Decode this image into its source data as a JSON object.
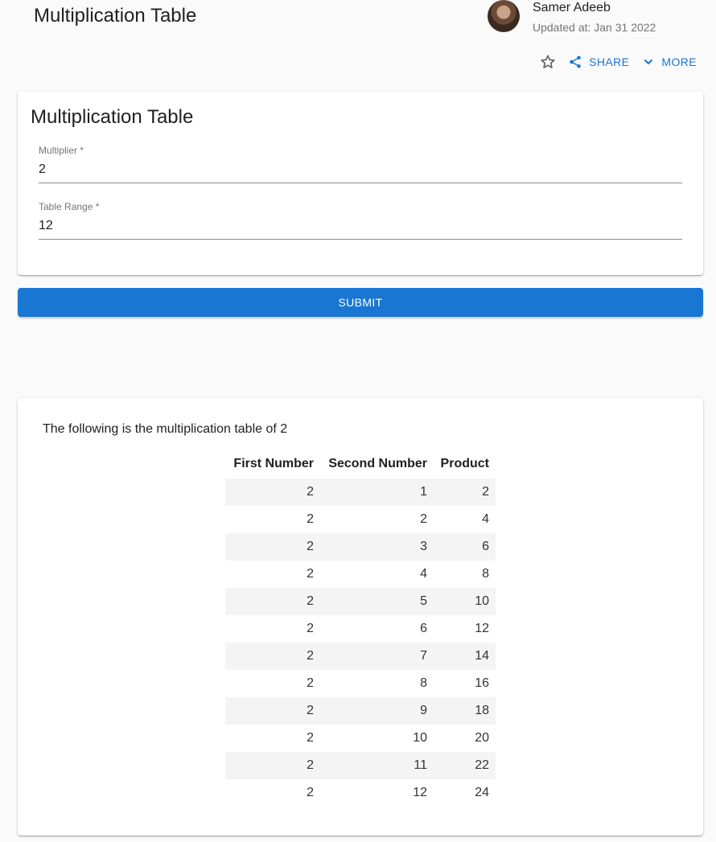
{
  "header": {
    "title": "Multiplication Table",
    "author_name": "Samer Adeeb",
    "updated": "Updated at: Jan 31 2022",
    "icons": {
      "avatar": "author-avatar",
      "favorite": "star-outline-icon",
      "share": "share-icon",
      "more": "chevron-down-icon"
    },
    "share_label": "SHARE",
    "more_label": "MORE"
  },
  "form": {
    "title": "Multiplication Table",
    "multiplier_label": "Multiplier *",
    "multiplier_value": "2",
    "range_label": "Table Range *",
    "range_value": "12",
    "submit_label": "SUBMIT"
  },
  "result": {
    "intro": "The following is the multiplication table of 2",
    "columns": [
      "First Number",
      "Second Number",
      "Product"
    ],
    "rows": [
      [
        "2",
        "1",
        "2"
      ],
      [
        "2",
        "2",
        "4"
      ],
      [
        "2",
        "3",
        "6"
      ],
      [
        "2",
        "4",
        "8"
      ],
      [
        "2",
        "5",
        "10"
      ],
      [
        "2",
        "6",
        "12"
      ],
      [
        "2",
        "7",
        "14"
      ],
      [
        "2",
        "8",
        "16"
      ],
      [
        "2",
        "9",
        "18"
      ],
      [
        "2",
        "10",
        "20"
      ],
      [
        "2",
        "11",
        "22"
      ],
      [
        "2",
        "12",
        "24"
      ]
    ]
  },
  "colors": {
    "accent": "#1976d2",
    "text": "#212121",
    "muted": "#757575",
    "stripe": "#f4f4f4"
  }
}
